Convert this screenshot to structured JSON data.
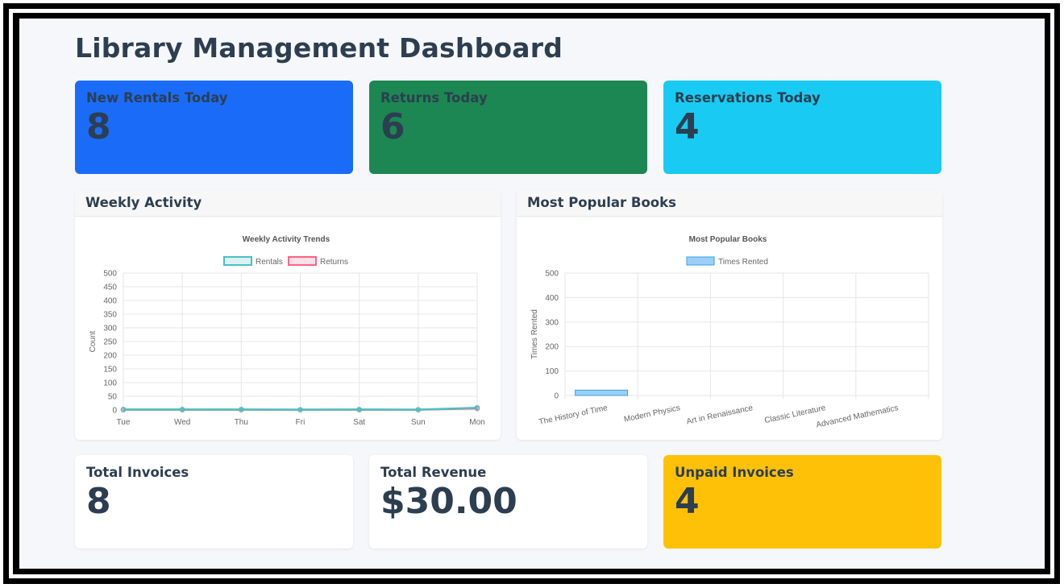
{
  "page": {
    "title": "Library Management Dashboard"
  },
  "top_stats": [
    {
      "label": "New Rentals Today",
      "value": "8",
      "color": "#1a6cf8"
    },
    {
      "label": "Returns Today",
      "value": "6",
      "color": "#1c8752"
    },
    {
      "label": "Reservations Today",
      "value": "4",
      "color": "#19cbf2"
    }
  ],
  "panels": {
    "weekly": {
      "header": "Weekly Activity"
    },
    "popular": {
      "header": "Most Popular Books"
    }
  },
  "bottom_stats": [
    {
      "label": "Total Invoices",
      "value": "8",
      "color": "#ffffff"
    },
    {
      "label": "Total Revenue",
      "value": "$30.00",
      "color": "#ffffff"
    },
    {
      "label": "Unpaid Invoices",
      "value": "4",
      "color": "#ffc107"
    }
  ],
  "chart_data": [
    {
      "type": "line",
      "title": "Weekly Activity Trends",
      "xlabel": "",
      "ylabel": "Count",
      "ylim": [
        0,
        500
      ],
      "yticks": [
        "0",
        "50",
        "100",
        "150",
        "200",
        "250",
        "300",
        "350",
        "400",
        "450",
        "500"
      ],
      "categories": [
        "Tue",
        "Wed",
        "Thu",
        "Fri",
        "Sat",
        "Sun",
        "Mon"
      ],
      "legend_position": "top",
      "grid": true,
      "series": [
        {
          "name": "Rentals",
          "values": [
            2,
            2,
            2,
            1,
            2,
            1,
            8
          ],
          "color": "#4bc0c0"
        },
        {
          "name": "Returns",
          "values": [
            1,
            1,
            1,
            1,
            1,
            1,
            6
          ],
          "color": "#ff6384"
        }
      ]
    },
    {
      "type": "bar",
      "title": "Most Popular Books",
      "xlabel": "",
      "ylabel": "Times Rented",
      "ylim": [
        0,
        500
      ],
      "yticks": [
        "0",
        "100",
        "200",
        "300",
        "400",
        "500"
      ],
      "categories": [
        "The History of Time",
        "Modern Physics",
        "Art in Renaissance",
        "Classic Literature",
        "Advanced Mathematics"
      ],
      "legend_position": "top",
      "grid": true,
      "series": [
        {
          "name": "Times Rented",
          "values": [
            22,
            0,
            0,
            0,
            0
          ],
          "color": "#36a2eb"
        }
      ]
    }
  ]
}
